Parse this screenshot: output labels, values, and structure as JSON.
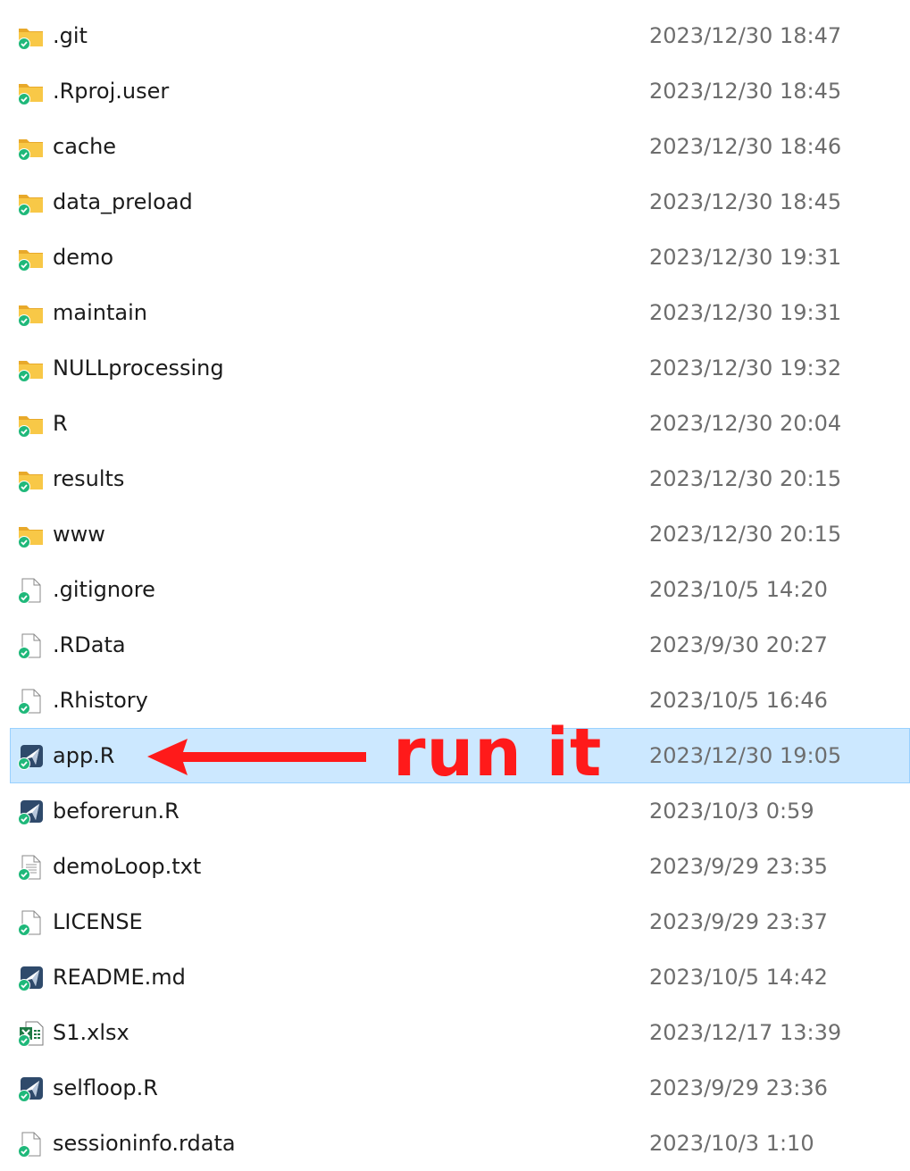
{
  "files": [
    {
      "name": ".git",
      "modified": "2023/12/30 18:47",
      "icon": "folder-icon"
    },
    {
      "name": ".Rproj.user",
      "modified": "2023/12/30 18:45",
      "icon": "folder-icon"
    },
    {
      "name": "cache",
      "modified": "2023/12/30 18:46",
      "icon": "folder-icon"
    },
    {
      "name": "data_preload",
      "modified": "2023/12/30 18:45",
      "icon": "folder-icon"
    },
    {
      "name": "demo",
      "modified": "2023/12/30 19:31",
      "icon": "folder-icon"
    },
    {
      "name": "maintain",
      "modified": "2023/12/30 19:31",
      "icon": "folder-icon"
    },
    {
      "name": "NULLprocessing",
      "modified": "2023/12/30 19:32",
      "icon": "folder-icon"
    },
    {
      "name": "R",
      "modified": "2023/12/30 20:04",
      "icon": "folder-icon"
    },
    {
      "name": "results",
      "modified": "2023/12/30 20:15",
      "icon": "folder-icon"
    },
    {
      "name": "www",
      "modified": "2023/12/30 20:15",
      "icon": "folder-icon"
    },
    {
      "name": ".gitignore",
      "modified": "2023/10/5 14:20",
      "icon": "blank-file-icon"
    },
    {
      "name": ".RData",
      "modified": "2023/9/30 20:27",
      "icon": "blank-file-icon"
    },
    {
      "name": ".Rhistory",
      "modified": "2023/10/5 16:46",
      "icon": "blank-file-icon"
    },
    {
      "name": "app.R",
      "modified": "2023/12/30 19:05",
      "icon": "r-script-icon",
      "selected": true
    },
    {
      "name": "beforerun.R",
      "modified": "2023/10/3 0:59",
      "icon": "r-script-icon"
    },
    {
      "name": "demoLoop.txt",
      "modified": "2023/9/29 23:35",
      "icon": "text-file-icon"
    },
    {
      "name": "LICENSE",
      "modified": "2023/9/29 23:37",
      "icon": "blank-file-icon"
    },
    {
      "name": "README.md",
      "modified": "2023/10/5 14:42",
      "icon": "r-script-icon"
    },
    {
      "name": "S1.xlsx",
      "modified": "2023/12/17 13:39",
      "icon": "excel-file-icon"
    },
    {
      "name": "selfloop.R",
      "modified": "2023/9/29 23:36",
      "icon": "r-script-icon"
    },
    {
      "name": "sessioninfo.rdata",
      "modified": "2023/10/3 1:10",
      "icon": "blank-file-icon"
    }
  ],
  "annotation": {
    "text": "run it",
    "color": "#ff1a1a"
  },
  "colors": {
    "selection_bg": "#cce8ff",
    "selection_border": "#99d1ff",
    "folder": "#f8c847",
    "sync_check": "#1fb87a"
  }
}
